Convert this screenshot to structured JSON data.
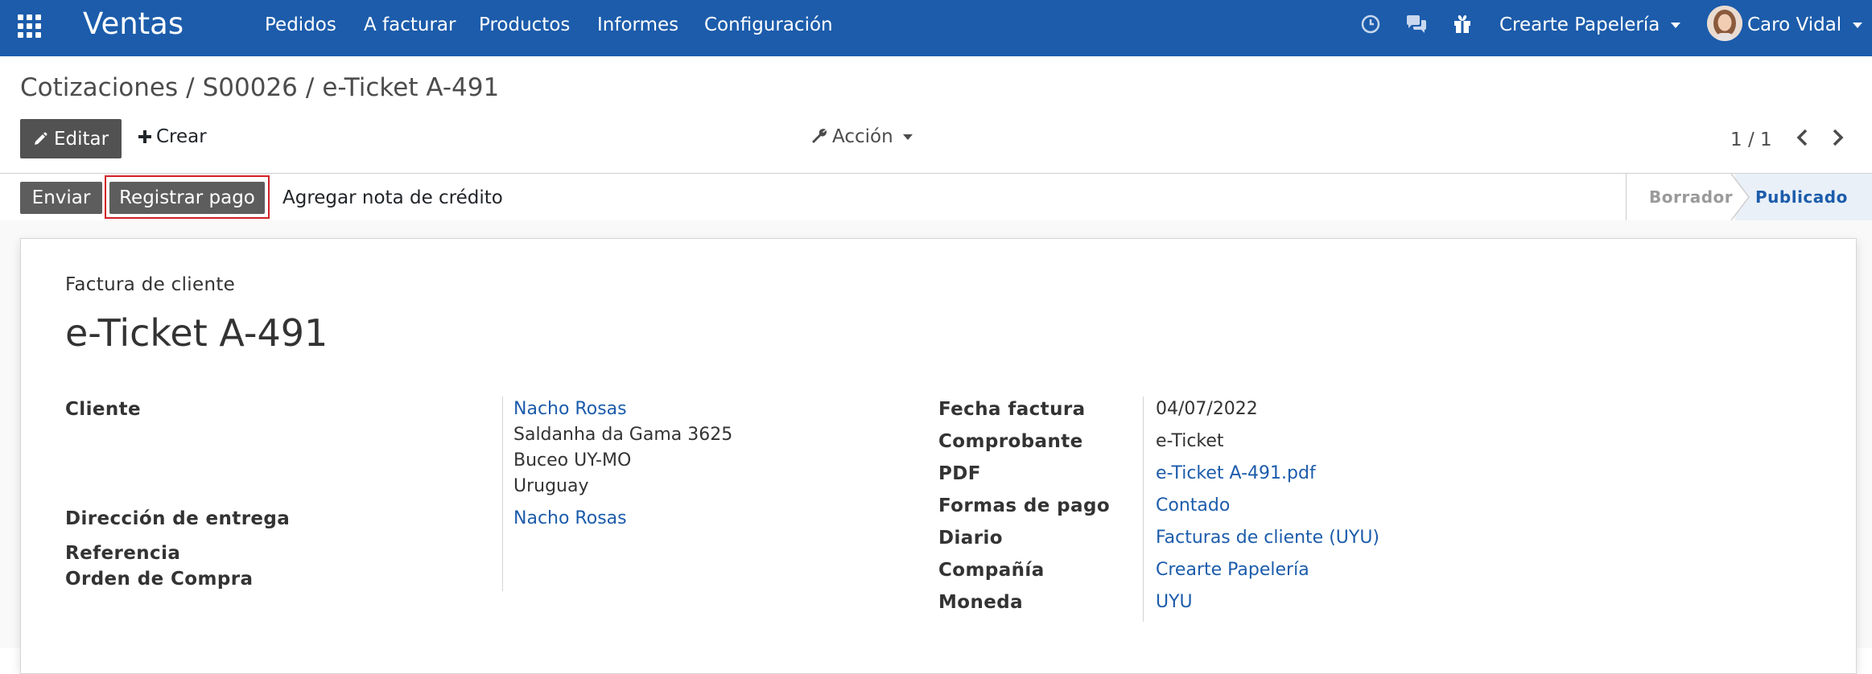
{
  "navbar": {
    "brand": "Ventas",
    "menu": [
      "Pedidos",
      "A facturar",
      "Productos",
      "Informes",
      "Configuración"
    ],
    "icons": [
      "clock-icon",
      "chat-icon",
      "gift-icon"
    ],
    "company": "Crearte Papelería",
    "user": "Caro Vidal",
    "bg_color": "#1c5cab"
  },
  "breadcrumb": {
    "items": [
      "Cotizaciones",
      "S00026",
      "e-Ticket A-491"
    ],
    "separator": "/"
  },
  "toolbar": {
    "edit_label": "Editar",
    "create_label": "Crear",
    "action_label": "Acción",
    "pager": "1 / 1"
  },
  "statusbar": {
    "buttons": [
      "Enviar",
      "Registrar pago",
      "Agregar nota de crédito"
    ],
    "stages": [
      "Borrador",
      "Publicado"
    ],
    "active_stage": "Publicado"
  },
  "form": {
    "doc_type": "Factura de cliente",
    "doc_name": "e-Ticket A-491",
    "left": {
      "cliente_label": "Cliente",
      "cliente_name": "Nacho Rosas",
      "address": [
        "Saldanha da Gama 3625",
        "Buceo UY-MO",
        "Uruguay"
      ],
      "direccion_label": "Dirección de entrega",
      "direccion_value": "Nacho Rosas",
      "referencia_label": "Referencia",
      "orden_label": "Orden de Compra"
    },
    "right": [
      {
        "label": "Fecha factura",
        "value": "04/07/2022",
        "link": false
      },
      {
        "label": "Comprobante",
        "value": "e-Ticket",
        "link": false
      },
      {
        "label": "PDF",
        "value": "e-Ticket A-491.pdf",
        "link": true
      },
      {
        "label": "Formas de pago",
        "value": "Contado",
        "link": true
      },
      {
        "label": "Diario",
        "value": "Facturas de cliente (UYU)",
        "link": true
      },
      {
        "label": "Compañía",
        "value": "Crearte Papelería",
        "link": true
      },
      {
        "label": "Moneda",
        "value": "UYU",
        "link": true
      }
    ]
  }
}
